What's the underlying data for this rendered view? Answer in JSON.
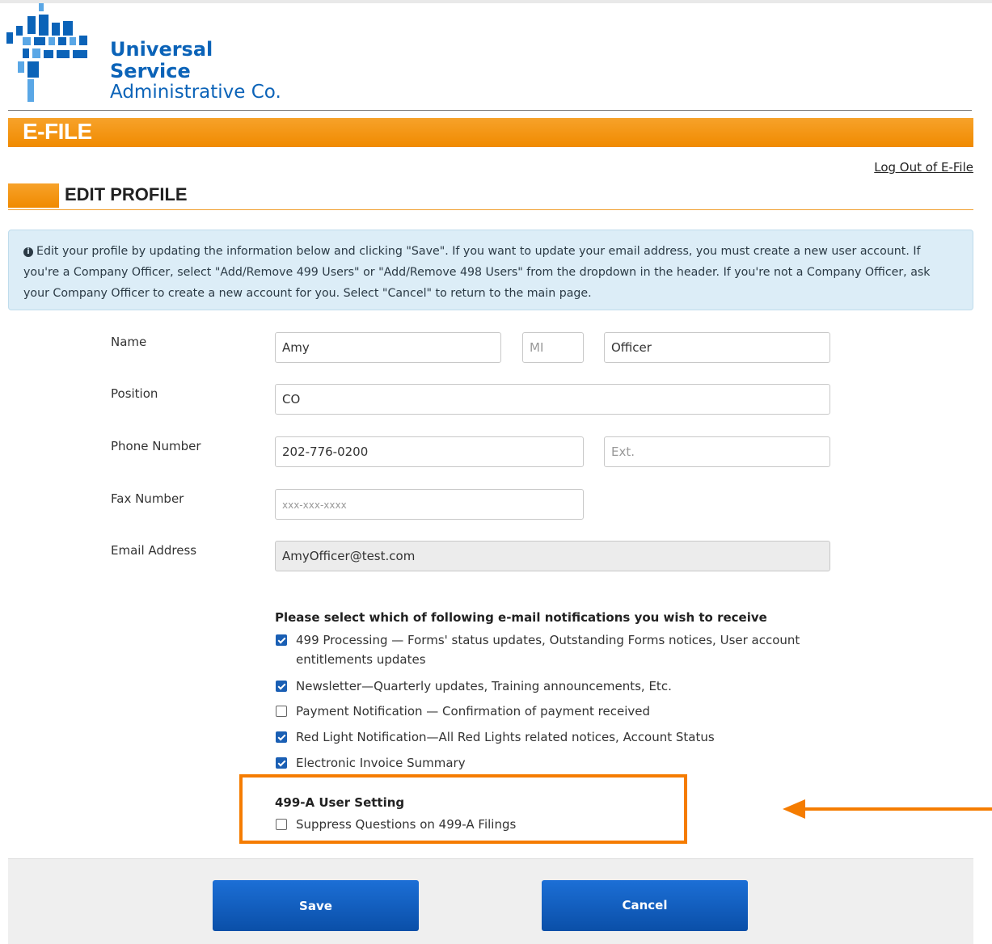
{
  "brand": {
    "name_line1": "Universal Service",
    "name_line2": "Administrative Co.",
    "colors": {
      "blue": "#0b63b8",
      "light_blue": "#5aa7e6"
    }
  },
  "header": {
    "section_title": "E-FILE",
    "logout_label": "Log Out of E-File",
    "accent_color": "#f39200"
  },
  "page": {
    "title": "EDIT PROFILE"
  },
  "info": {
    "icon": "info-circle-icon",
    "text": "Edit your profile by updating the information below and clicking \"Save\". If you want to update your email address, you must create a new user account. If you're a Company Officer, select \"Add/Remove 499 Users\" or \"Add/Remove 498 Users\" from the dropdown in the header. If you're not a Company Officer, ask your Company Officer to create a new account for you. Select \"Cancel\" to return to the main page."
  },
  "form": {
    "name": {
      "label": "Name",
      "first": "Amy",
      "mi_placeholder": "MI",
      "mi": "",
      "last": "Officer"
    },
    "position": {
      "label": "Position",
      "value": "CO"
    },
    "phone": {
      "label": "Phone Number",
      "value": "202-776-0200",
      "ext_placeholder": "Ext.",
      "ext": ""
    },
    "fax": {
      "label": "Fax Number",
      "placeholder": "xxx-xxx-xxxx",
      "value": ""
    },
    "email": {
      "label": "Email Address",
      "value": "AmyOfficer@test.com"
    }
  },
  "notifications": {
    "heading": "Please select which of following e-mail notifications you wish to receive",
    "items": [
      {
        "label": "499 Processing — Forms' status updates, Outstanding Forms notices, User account entitlements updates",
        "checked": true
      },
      {
        "label": "Newsletter—Quarterly updates, Training announcements, Etc.",
        "checked": true
      },
      {
        "label": "Payment Notification — Confirmation of payment received",
        "checked": false
      },
      {
        "label": "Red Light Notification—All Red Lights related notices, Account Status",
        "checked": true
      },
      {
        "label": "Electronic Invoice Summary",
        "checked": true
      }
    ]
  },
  "user_setting": {
    "heading": "499-A User Setting",
    "items": [
      {
        "label": "Suppress Questions on 499-A Filings",
        "checked": false
      }
    ],
    "highlight_color": "#f57c00"
  },
  "annotation": {
    "icon": "arrow-left-icon",
    "color": "#f57c00"
  },
  "buttons": {
    "save_label": "Save",
    "cancel_label": "Cancel",
    "color": "#1463c4"
  }
}
